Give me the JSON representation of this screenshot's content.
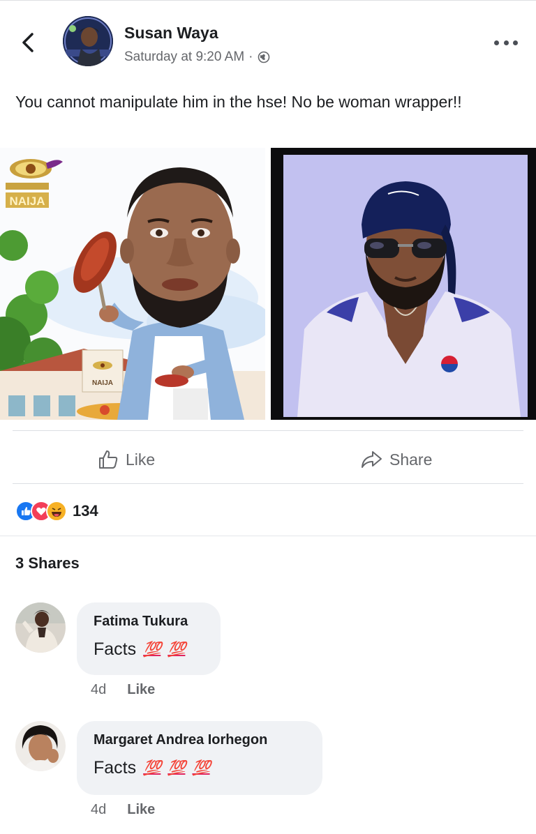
{
  "header": {
    "author_name": "Susan Waya",
    "timestamp": "Saturday at 9:20 AM",
    "separator": "·",
    "privacy_icon": "globe-icon"
  },
  "post": {
    "text": "You cannot manipulate him in the hse! No be woman wrapper!!",
    "image_left_logo_text": "NAIJA",
    "image_left_sign_text": "NAIJA"
  },
  "actions": {
    "like_label": "Like",
    "share_label": "Share"
  },
  "reactions": {
    "icons": [
      "like-reaction-icon",
      "love-reaction-icon",
      "haha-reaction-icon"
    ],
    "count": "134"
  },
  "shares": {
    "label": "3 Shares"
  },
  "comments": [
    {
      "author": "Fatima Tukura",
      "text": "Facts",
      "emojis": [
        "💯",
        "💯"
      ],
      "age": "4d",
      "like_label": "Like"
    },
    {
      "author": "Margaret Andrea Iorhegon",
      "text": "Facts",
      "emojis": [
        "💯",
        "💯",
        "💯"
      ],
      "age": "4d",
      "like_label": "Like"
    }
  ],
  "colors": {
    "primary_text": "#1c1e21",
    "secondary_text": "#65676b",
    "bubble_bg": "#f0f2f5",
    "like_blue": "#1877f2",
    "love_red": "#f33e58",
    "haha_yellow": "#f7b125"
  }
}
